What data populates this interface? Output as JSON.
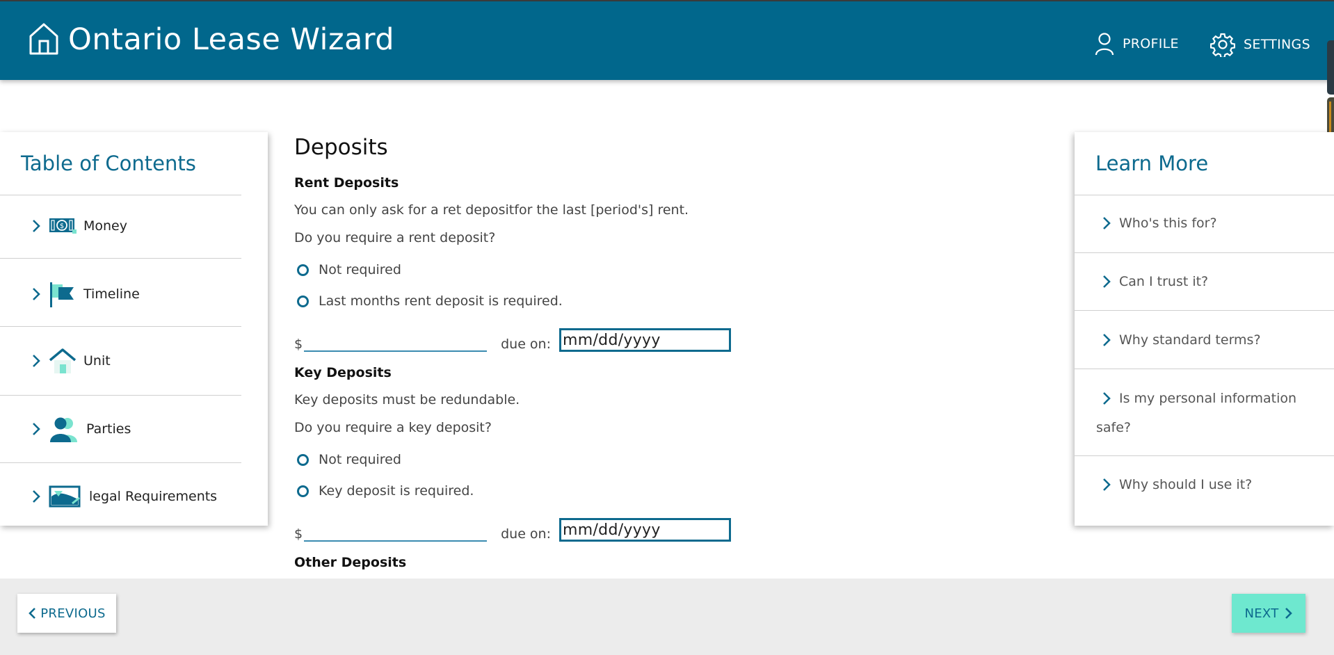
{
  "header": {
    "title": "Ontario Lease Wizard",
    "logo_icon": "house-outline-icon",
    "nav": [
      {
        "label": "PROFILE",
        "icon": "person-icon"
      },
      {
        "label": "SETTINGS",
        "icon": "gear-icon"
      }
    ],
    "background": "#01678c"
  },
  "toc": {
    "title": "Table of Contents",
    "items": [
      {
        "label": "Money",
        "icon": "money-icon"
      },
      {
        "label": "Timeline",
        "icon": "flag-icon"
      },
      {
        "label": "Unit",
        "icon": "home-icon"
      },
      {
        "label": "Parties",
        "icon": "people-icon"
      },
      {
        "label": "legal Requirements",
        "icon": "document-icon"
      }
    ]
  },
  "main": {
    "heading": "Deposits",
    "rent": {
      "title": "Rent Deposits",
      "info": "You can only ask for a ret depositfor the last [period's] rent.",
      "question": "Do you require a rent deposit?",
      "options": [
        "Not required",
        "Last months rent deposit is required."
      ],
      "currency": "$",
      "amount_value": "",
      "due_label": "due on:",
      "date_placeholder": "mm/dd/yyyy"
    },
    "key": {
      "title": "Key Deposits",
      "info": "Key deposits must be redundable.",
      "question": "Do you require a key deposit?",
      "options": [
        "Not required",
        "Key deposit is required."
      ],
      "currency": "$",
      "amount_value": "",
      "due_label": "due on:",
      "date_placeholder": "mm/dd/yyyy"
    },
    "other": {
      "title": "Other Deposits"
    }
  },
  "learn": {
    "title": "Learn More",
    "items": [
      "Who's this for?",
      "Can I trust it?",
      "Why standard terms?",
      "Is my personal information",
      "safe?",
      "Why should I use it?"
    ]
  },
  "footer": {
    "previous_label": "PREVIOUS",
    "next_label": "NEXT",
    "accent": "#6ee8cf"
  }
}
